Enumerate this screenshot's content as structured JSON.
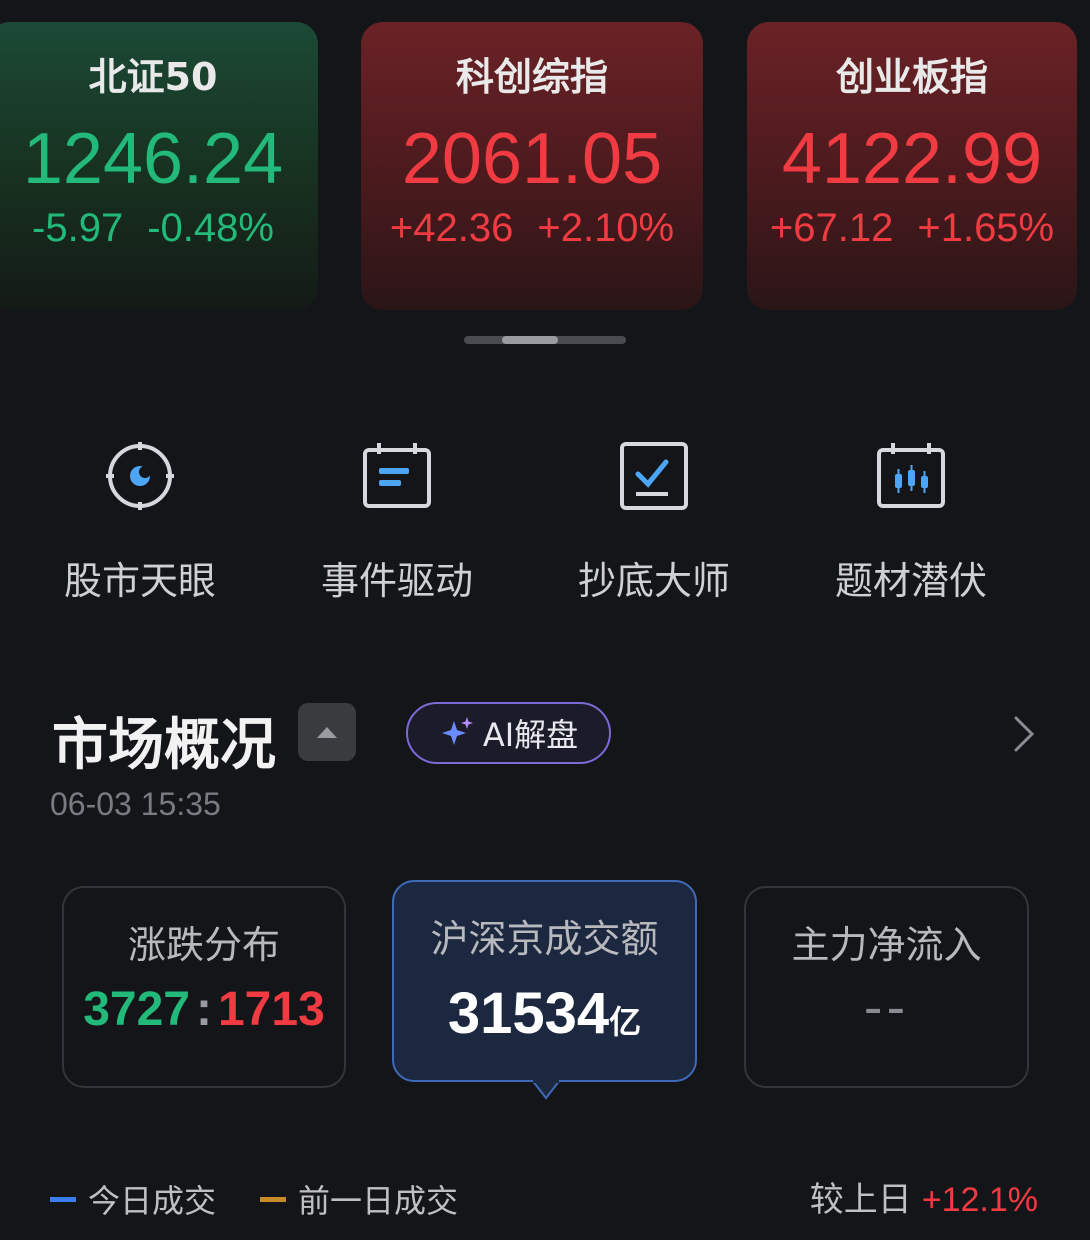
{
  "indices": [
    {
      "name": "北证50",
      "value": "1246.24",
      "change": "-5.97",
      "change_pct": "-0.48%",
      "trend": "down"
    },
    {
      "name": "科创综指",
      "value": "2061.05",
      "change": "+42.36",
      "change_pct": "+2.10%",
      "trend": "up"
    },
    {
      "name": "创业板指",
      "value": "4122.99",
      "change": "+67.12",
      "change_pct": "+1.65%",
      "trend": "up"
    }
  ],
  "tools": [
    {
      "label": "股市天眼",
      "icon": "eye-target-icon"
    },
    {
      "label": "事件驱动",
      "icon": "calendar-event-icon"
    },
    {
      "label": "抄底大师",
      "icon": "bottom-check-icon"
    },
    {
      "label": "题材潜伏",
      "icon": "candlestick-calendar-icon"
    }
  ],
  "market": {
    "title": "市场概况",
    "ai_label": "AI解盘",
    "timestamp": "06-03 15:35"
  },
  "stats": {
    "rise_fall": {
      "label": "涨跌分布",
      "rise": "3727",
      "sep": ":",
      "fall": "1713"
    },
    "volume": {
      "label": "沪深京成交额",
      "value": "31534",
      "unit": "亿"
    },
    "net_inflow": {
      "label": "主力净流入",
      "value": "--"
    }
  },
  "legend": {
    "today": "今日成交",
    "prev": "前一日成交",
    "compare_label": "较上日",
    "compare_value": "+12.1%"
  },
  "colors": {
    "up": "#f03b42",
    "down": "#22b97a",
    "today_line": "#3b7cf0",
    "prev_line": "#c98a2a",
    "accent_ai": "#7d6ad8"
  }
}
